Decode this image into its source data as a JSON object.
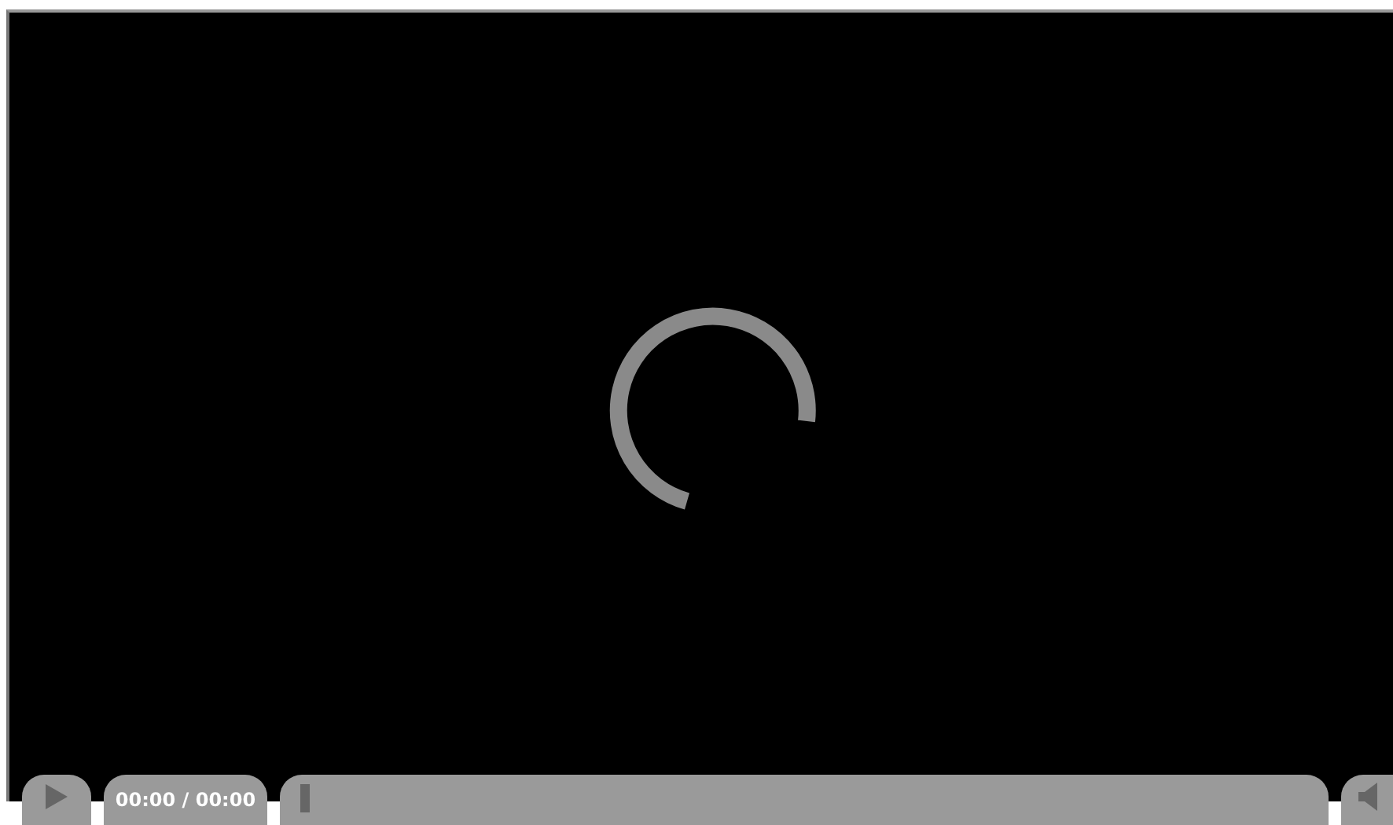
{
  "player": {
    "loading": true,
    "time": "00:00 / 00:00",
    "progress": {
      "level": 0.01
    }
  }
}
